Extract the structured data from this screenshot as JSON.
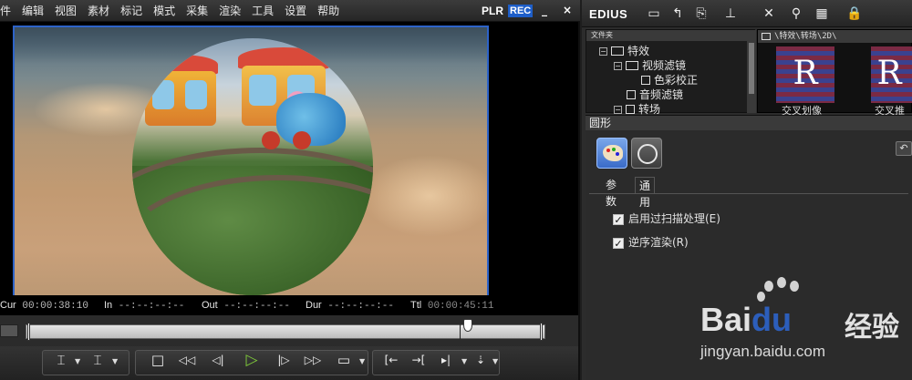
{
  "menubar": {
    "items": [
      "件",
      "编辑",
      "视图",
      "素材",
      "标记",
      "模式",
      "采集",
      "渲染",
      "工具",
      "设置",
      "帮助"
    ],
    "plr": "PLR",
    "rec": "REC",
    "minimize": "_",
    "maximize": "□",
    "close": "×"
  },
  "timecode": {
    "cur_label": "Cur",
    "cur_value": "00:00:38:10",
    "in_label": "In",
    "in_value": "--:--:--:--",
    "out_label": "Out",
    "out_value": "--:--:--:--",
    "dur_label": "Dur",
    "dur_value": "--:--:--:--",
    "ttl_label": "Ttl",
    "ttl_value": "00:00:45:11"
  },
  "playback": {
    "position": 0.85
  },
  "controls": {
    "mark_in": "⌶",
    "mark_out": "⌶",
    "stop": "□",
    "rewind": "◁◁",
    "step_back": "◁|",
    "play": "▷",
    "step_fwd": "|▷",
    "fast_fwd": "▷▷",
    "loop": "▭",
    "in_out_1": "[←",
    "in_out_2": "→[",
    "in_out_3": "▸|",
    "in_out_4": "⇣"
  },
  "right_toolbar": {
    "app_name": "EDIUS"
  },
  "bin": {
    "header": "文件夹",
    "tree": [
      {
        "label": "特效",
        "expander": "−"
      },
      {
        "label": "视频滤镜",
        "expander": "−"
      },
      {
        "label": "色彩校正",
        "expander": ""
      },
      {
        "label": "音频滤镜",
        "expander": ""
      },
      {
        "label": "转场",
        "expander": "−"
      }
    ]
  },
  "assets": {
    "path": "\\特效\\转场\\2D\\",
    "items": [
      {
        "label": "交叉划像",
        "glyph": "R"
      },
      {
        "label": "交叉推",
        "glyph": "R"
      }
    ]
  },
  "fx": {
    "title": "圆形",
    "tabs": [
      "参数",
      "通用"
    ],
    "active_tab": "通用",
    "options": [
      {
        "label": "启用过扫描处理(E)",
        "checked": "✓"
      },
      {
        "label": "逆序渲染(R)",
        "checked": "✓"
      }
    ],
    "undo": "↶"
  },
  "watermark": {
    "brand": "Bai",
    "brand_du": "du",
    "brand_cn": "经验",
    "url": "jingyan.baidu.com"
  },
  "colors": {
    "accent_blue": "#2d63c8",
    "rec_blue": "#1e5ec8",
    "play_green": "#7ec93a"
  }
}
